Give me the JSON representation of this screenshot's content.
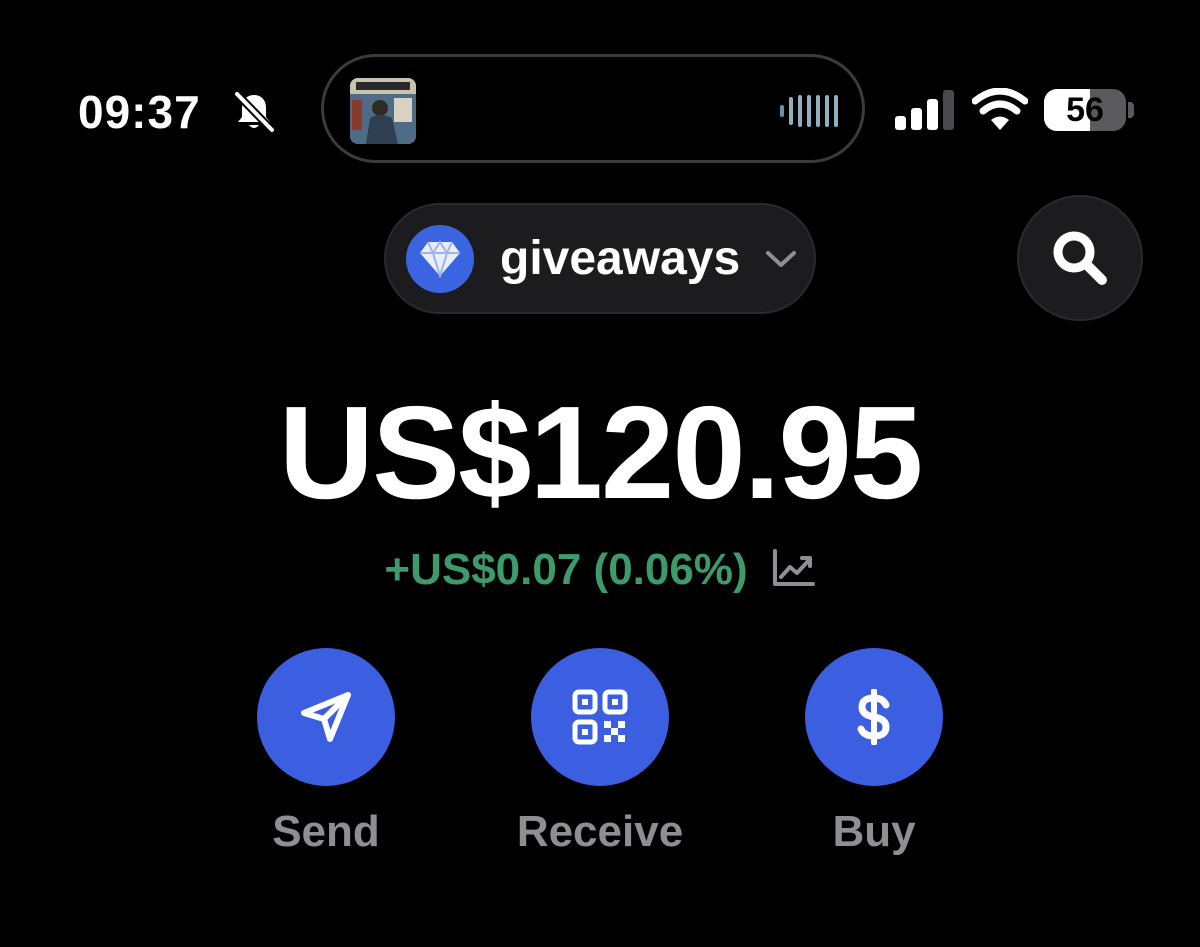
{
  "status_bar": {
    "time": "09:37",
    "silent_icon": "bell-slash-icon",
    "now_playing_icon": "album-art",
    "waveform_icon": "waveform-icon",
    "signal_icon": "cellular-signal-icon",
    "wifi_icon": "wifi-icon",
    "battery_level": "56",
    "battery_fraction": 0.56
  },
  "header": {
    "account_name": "giveaways",
    "account_icon": "diamond-icon",
    "dropdown_icon": "chevron-down-icon",
    "search_icon": "search-icon"
  },
  "balance": {
    "amount": "US$120.95",
    "change": "+US$0.07 (0.06%)",
    "change_color": "#3d9b6b",
    "chart_icon": "trend-chart-icon"
  },
  "actions": [
    {
      "label": "Send",
      "icon": "send-icon"
    },
    {
      "label": "Receive",
      "icon": "qr-code-icon"
    },
    {
      "label": "Buy",
      "icon": "dollar-icon"
    }
  ],
  "colors": {
    "accent": "#3b5fe0",
    "background": "#000000",
    "positive": "#3d9b6b",
    "label_gray": "#8e8e93"
  }
}
